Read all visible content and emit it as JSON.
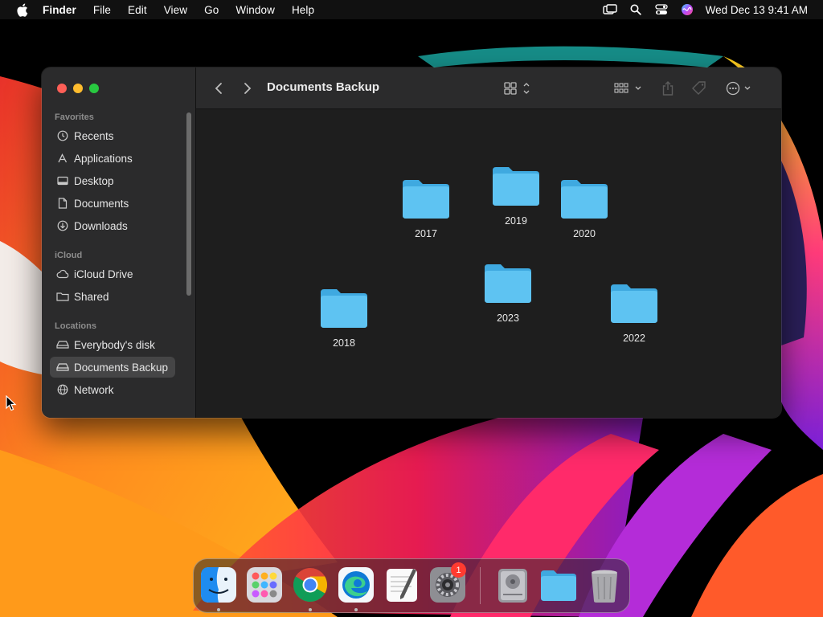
{
  "menubar": {
    "app_name": "Finder",
    "menus": [
      "File",
      "Edit",
      "View",
      "Go",
      "Window",
      "Help"
    ],
    "clock": "Wed Dec 13  9:41 AM",
    "status_icons": [
      "screen-mirroring-icon",
      "spotlight-search-icon",
      "control-center-icon",
      "siri-icon"
    ]
  },
  "window": {
    "title": "Documents Backup",
    "sidebar": {
      "sections": [
        {
          "label": "Favorites",
          "items": [
            "Recents",
            "Applications",
            "Desktop",
            "Documents",
            "Downloads"
          ]
        },
        {
          "label": "iCloud",
          "items": [
            "iCloud Drive",
            "Shared"
          ]
        },
        {
          "label": "Locations",
          "items": [
            "Everybody's disk",
            "Documents Backup",
            "Network"
          ]
        }
      ],
      "selected": "Documents Backup"
    },
    "folders": [
      "2017",
      "2019",
      "2020",
      "2018",
      "2023",
      "2022"
    ],
    "colors": {
      "folder": "#5ec3f2",
      "folder_tab": "#3fa9e0",
      "selection": "#454546"
    }
  },
  "dock": {
    "apps": [
      "Finder",
      "Launchpad",
      "Google Chrome",
      "Microsoft Edge",
      "TextEdit",
      "System Settings",
      "Disk Utility",
      "Downloads Folder",
      "Trash"
    ],
    "settings_badge": "1"
  }
}
